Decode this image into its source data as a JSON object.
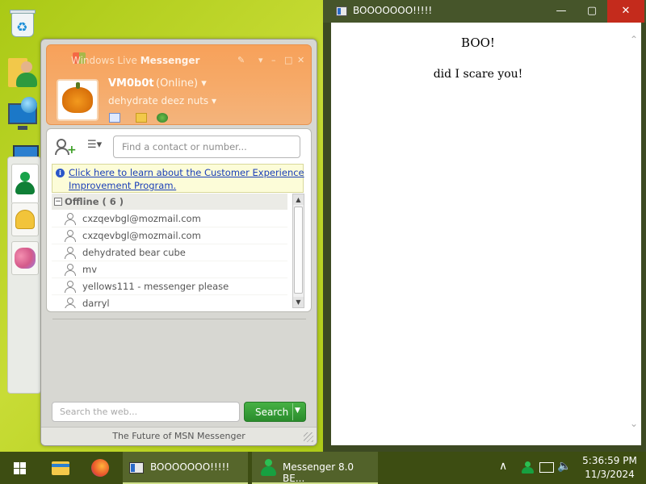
{
  "messenger": {
    "title_prefix": "Windows Live",
    "title_suffix": "Messenger",
    "nickname": "VM0b0t",
    "status": "(Online)",
    "personal_message": "dehydrate deez nuts",
    "find_placeholder": "Find a contact or number...",
    "cep_line1": "Click here to learn about the Customer Experience",
    "cep_line2": "Improvement Program.",
    "group_label": "Offline ( 6 )",
    "contacts": [
      "cxzqevbgl@mozmail.com",
      "cxzqevbgl@mozmail.com",
      "dehydrated bear cube",
      "mv",
      "yellows111 - messenger please",
      "darryl"
    ],
    "web_search_placeholder": "Search the web...",
    "search_button": "Search",
    "footer": "The Future of MSN Messenger"
  },
  "browser": {
    "title": "BOOOOOOO!!!!!",
    "heading": "BOO!",
    "text": "did I scare you!"
  },
  "taskbar": {
    "task_browser": "BOOOOOOO!!!!!",
    "task_messenger": "Messenger 8.0 BE...",
    "time": "5:36:59 PM",
    "date": "11/3/2024"
  },
  "colors": {
    "accent_orange": "#f6a967",
    "search_green": "#2a8c2c",
    "taskbar": "#3d4d12",
    "close_red": "#c42b1c"
  }
}
